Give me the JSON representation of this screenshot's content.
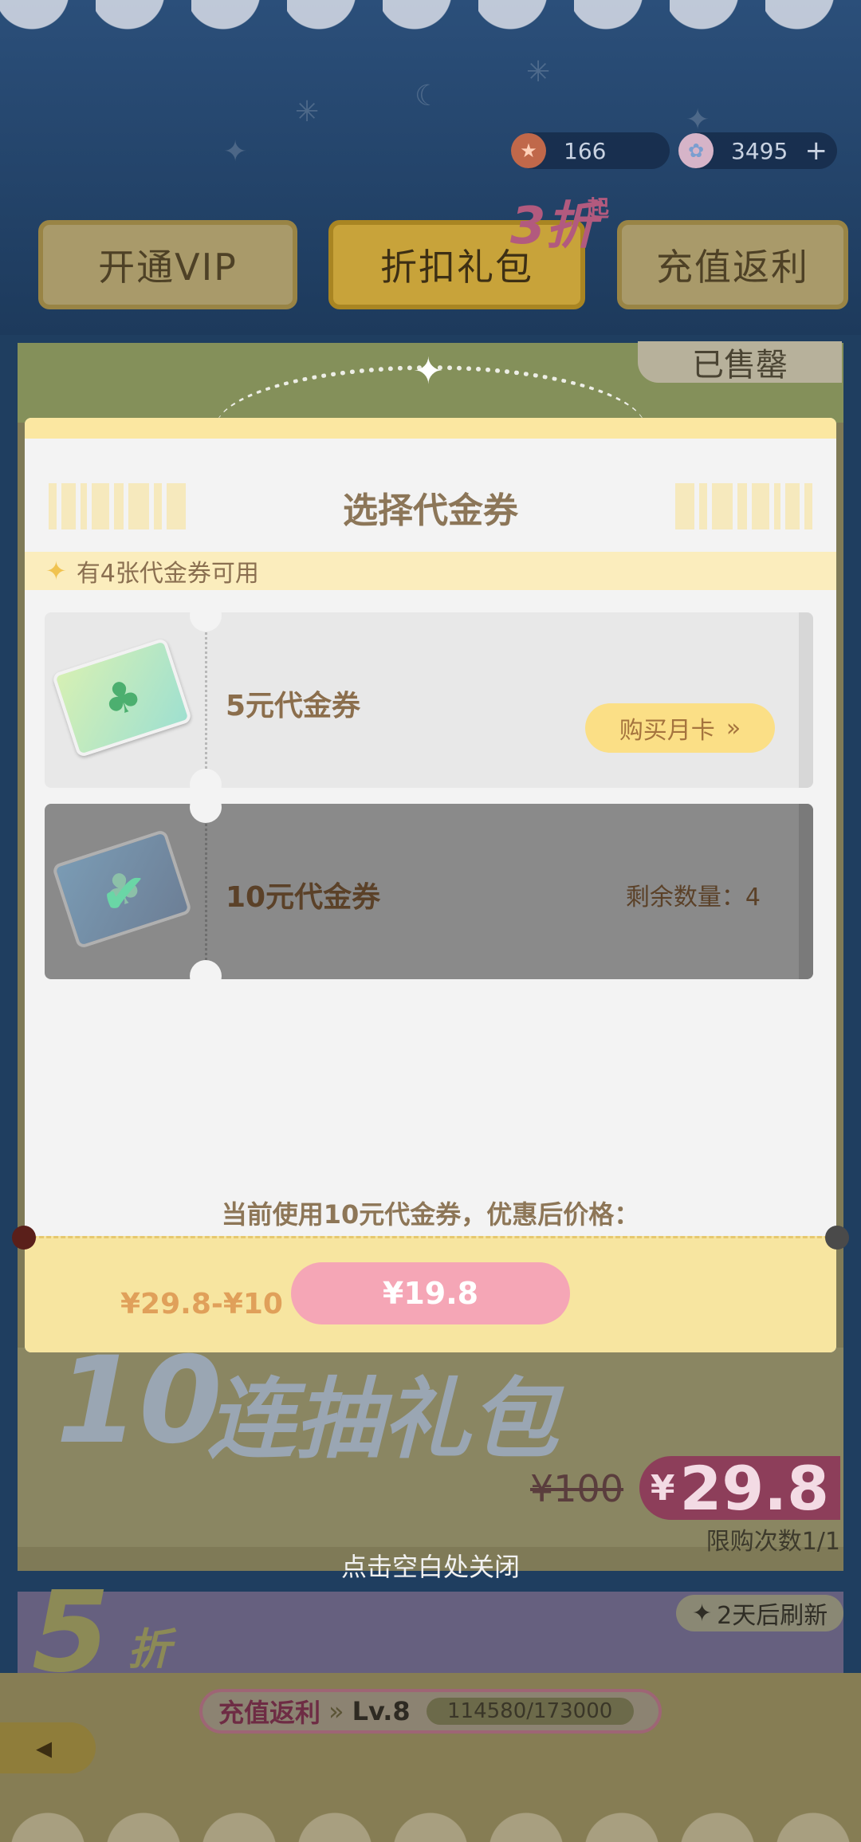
{
  "header": {
    "star_currency": "166",
    "gem_currency": "3495",
    "plus_icon": "plus-icon"
  },
  "tabs": [
    {
      "label": "开通VIP"
    },
    {
      "label": "折扣礼包"
    },
    {
      "label": "充值返利"
    }
  ],
  "discount_badge": {
    "value": "3折",
    "suffix": "起"
  },
  "sold_out_label": "已售罄",
  "modal": {
    "title": "选择代金券",
    "available_text": "有4张代金券可用",
    "vouchers": [
      {
        "name": "5元代金券",
        "action_label": "购买月卡",
        "selected": false
      },
      {
        "name": "10元代金券",
        "remaining_label": "剩余数量：4",
        "selected": true
      }
    ],
    "price_note": "当前使用10元代金券，优惠后价格：",
    "calc_text": "¥29.8-¥10",
    "final_price": "¥19.8"
  },
  "promo": {
    "title_number": "10",
    "title_text": "连抽礼包",
    "old_price": "¥100",
    "new_price_symbol": "¥",
    "new_price": "29.8",
    "limit_text": "限购次数1/1"
  },
  "close_hint": "点击空白处关闭",
  "five_discount": {
    "badge": "5",
    "suffix": "折",
    "refresh_text": "2天后刷新"
  },
  "rebate_bar": {
    "label": "充值返利",
    "level": "Lv.8",
    "progress_text": "114580/173000"
  },
  "colors": {
    "modal_bg": "#f3f3f3",
    "accent_yellow": "#fbdf86",
    "pink_button": "#f5a6b6",
    "title_brown": "#8c7658"
  }
}
